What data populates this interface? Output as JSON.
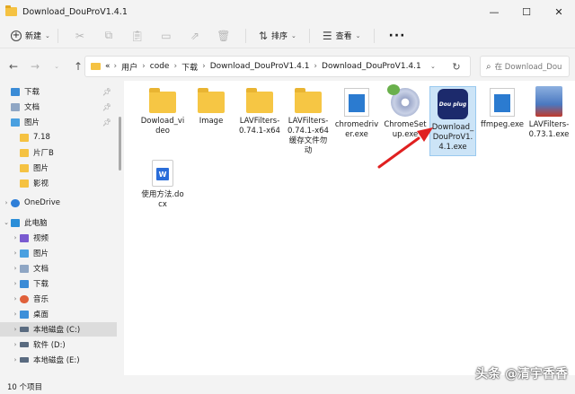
{
  "window": {
    "title": "Download_DouProV1.4.1"
  },
  "toolbar": {
    "new_label": "新建",
    "sort_label": "排序",
    "view_label": "查看",
    "more_label": "···"
  },
  "address": {
    "prefix": "«",
    "crumbs": [
      "用户",
      "code",
      "下载",
      "Download_DouProV1.4.1",
      "Download_DouProV1.4.1"
    ]
  },
  "search": {
    "placeholder": "在 Download_Dou"
  },
  "sidebar": {
    "items": [
      {
        "label": "下载",
        "icon": "download-icon"
      },
      {
        "label": "文档",
        "icon": "document-icon"
      },
      {
        "label": "图片",
        "icon": "picture-icon"
      },
      {
        "label": "7.18",
        "icon": "folder-icon"
      },
      {
        "label": "片厂B",
        "icon": "folder-icon"
      },
      {
        "label": "图片",
        "icon": "folder-icon"
      },
      {
        "label": "影视",
        "icon": "folder-icon"
      },
      {
        "label": "OneDrive",
        "icon": "cloud-icon"
      },
      {
        "label": "此电脑",
        "icon": "computer-icon"
      },
      {
        "label": "视频",
        "icon": "video-icon"
      },
      {
        "label": "图片",
        "icon": "picture-icon"
      },
      {
        "label": "文档",
        "icon": "document-icon"
      },
      {
        "label": "下载",
        "icon": "download-icon"
      },
      {
        "label": "音乐",
        "icon": "music-icon"
      },
      {
        "label": "桌面",
        "icon": "desktop-icon"
      },
      {
        "label": "本地磁盘 (C:)",
        "icon": "drive-icon"
      },
      {
        "label": "软件 (D:)",
        "icon": "drive-icon"
      },
      {
        "label": "本地磁盘 (E:)",
        "icon": "drive-icon"
      }
    ]
  },
  "files": [
    {
      "name": "Dowload_video",
      "type": "folder"
    },
    {
      "name": "Image",
      "type": "folder"
    },
    {
      "name": "LAVFilters-0.74.1-x64",
      "type": "folder"
    },
    {
      "name": "LAVFilters-0.74.1-x64缓存文件勿动",
      "type": "folder"
    },
    {
      "name": "chromedriver.exe",
      "type": "exe"
    },
    {
      "name": "ChromeSetup.exe",
      "type": "setup"
    },
    {
      "name": "Download_DouProV1.4.1.exe",
      "type": "app",
      "icon_text": "Dou plug"
    },
    {
      "name": "ffmpeg.exe",
      "type": "exe"
    },
    {
      "name": "LAVFilters-0.73.1.exe",
      "type": "package"
    },
    {
      "name": "使用方法.docx",
      "type": "docx"
    }
  ],
  "status": {
    "count": "10 个项目"
  },
  "watermark": "头条 @清宇香香",
  "colors": {
    "accent": "#2b7bd0",
    "arrow": "#e02020",
    "folder": "#f6c644"
  }
}
